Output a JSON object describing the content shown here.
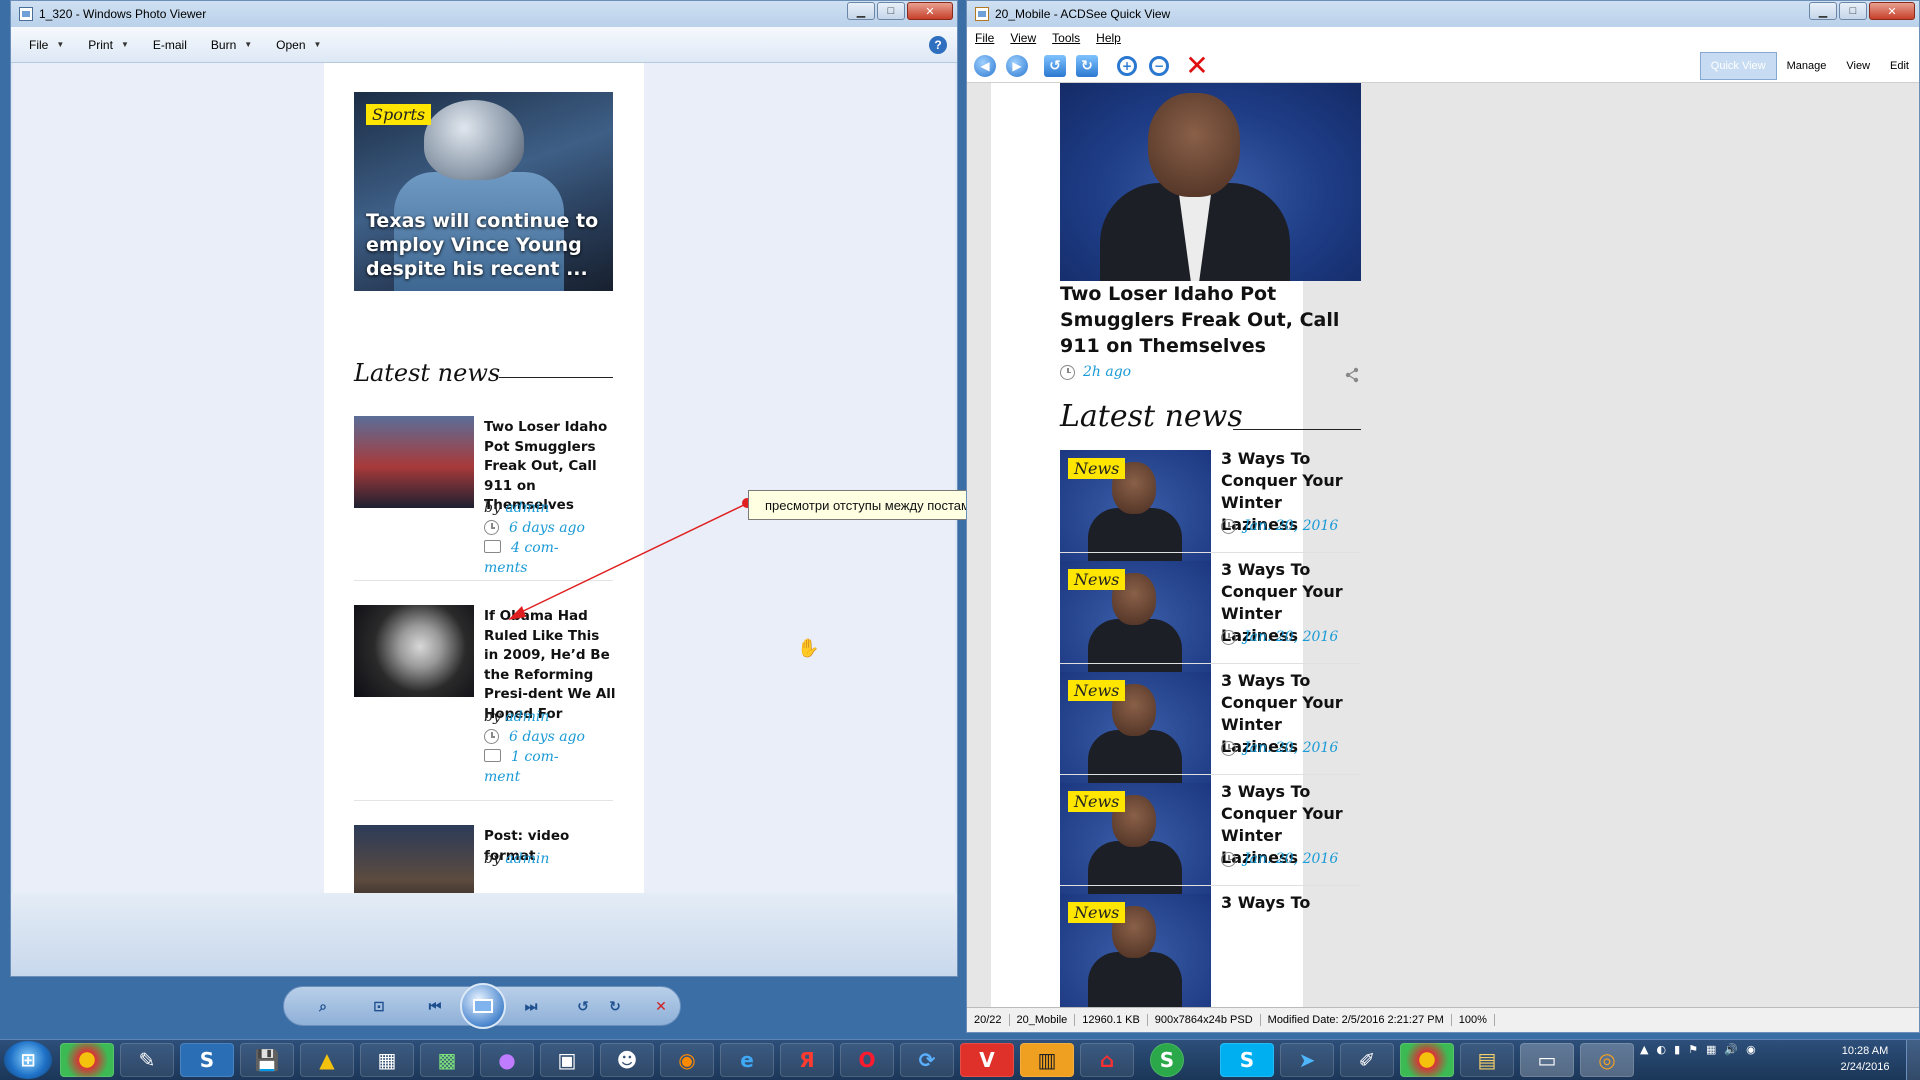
{
  "photo_viewer": {
    "title": "1_320 - Windows Photo Viewer",
    "menu": {
      "file": "File",
      "print": "Print",
      "email": "E-mail",
      "burn": "Burn",
      "open": "Open"
    },
    "page": {
      "hero_tag": "Sports",
      "hero_title": "Texas will continue to employ Vince Young despite his recent ...",
      "latest_news": "Latest news",
      "posts": [
        {
          "title": "Two Loser Idaho Pot Smugglers Freak Out, Call 911 on Themselves",
          "by": "by",
          "author": "admin",
          "time": "6 days ago",
          "comments_1": "4 com-",
          "comments_2": "ments"
        },
        {
          "title": "If Obama Had Ruled Like This in 2009, He’d Be the Reforming Presi-dent We All Hoped For",
          "by": "by",
          "author": "admin",
          "time": "6 days ago",
          "comments_1": "1 com-",
          "comments_2": "ment"
        },
        {
          "title": "Post: video format",
          "by": "by",
          "author": "admin"
        }
      ]
    },
    "annotation": "пресмотри отступы между постами"
  },
  "acdsee": {
    "title": "20_Mobile - ACDSee Quick View",
    "menu": {
      "file": "File",
      "view": "View",
      "tools": "Tools",
      "help": "Help"
    },
    "modes": {
      "quick_view": "Quick View",
      "manage": "Manage",
      "view": "View",
      "edit": "Edit"
    },
    "page": {
      "featured_title": "Two Loser Idaho Pot Smugglers Freak Out, Call 911 on Themselves",
      "featured_time": "2h ago",
      "latest_news": "Latest news",
      "posts": [
        {
          "tag": "News",
          "title": "3 Ways To Conquer Your Winter Laziness",
          "date": "Jan. 20, 2016"
        },
        {
          "tag": "News",
          "title": "3 Ways To Conquer Your Winter Laziness",
          "date": "Jan. 20, 2016"
        },
        {
          "tag": "News",
          "title": "3 Ways To Conquer Your Winter Laziness",
          "date": "Jan. 20, 2016"
        },
        {
          "tag": "News",
          "title": "3 Ways To Conquer Your Winter Laziness",
          "date": "Jan. 20, 2016"
        },
        {
          "tag": "News",
          "title": "3 Ways To"
        }
      ]
    },
    "status": {
      "index": "20/22",
      "name": "20_Mobile",
      "size": "12960.1 KB",
      "dims": "900x7864x24b PSD",
      "modified": "Modified Date: 2/5/2016 2:21:27 PM",
      "zoom": "100%"
    }
  },
  "taskbar": {
    "time": "10:28 AM",
    "date": "2/24/2016",
    "app_glyphs": [
      "S",
      "Я",
      "S",
      "S"
    ]
  }
}
